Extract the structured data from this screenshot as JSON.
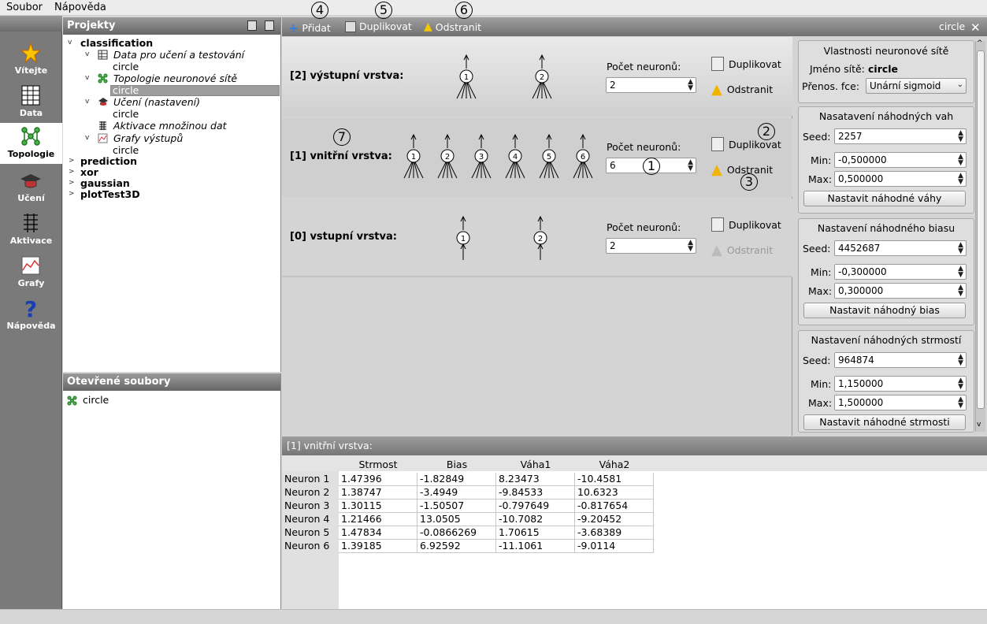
{
  "menu": {
    "file": "Soubor",
    "help": "Nápověda"
  },
  "nav": [
    {
      "label": "Vítejte",
      "icon": "star-icon"
    },
    {
      "label": "Data",
      "icon": "table-icon"
    },
    {
      "label": "Topologie",
      "icon": "network-icon"
    },
    {
      "label": "Učení",
      "icon": "graduation-cap-icon"
    },
    {
      "label": "Aktivace",
      "icon": "layers-icon"
    },
    {
      "label": "Grafy",
      "icon": "chart-icon"
    },
    {
      "label": "Nápověda",
      "icon": "question-icon"
    }
  ],
  "projects": {
    "title": "Projekty",
    "items": [
      "classification",
      "Data pro učení a testování",
      "circle",
      "Topologie neuronové sítě",
      "circle",
      "Učení (nastavení)",
      "circle",
      "Aktivace množinou dat",
      "Grafy výstupů",
      "circle",
      "prediction",
      "xor",
      "gaussian",
      "plotTest3D"
    ]
  },
  "open_files": {
    "title": "Otevřené soubory",
    "items": [
      "circle"
    ]
  },
  "toolbar": {
    "add": "Přidat",
    "duplicate": "Duplikovat",
    "remove": "Odstranit",
    "file_name": "circle"
  },
  "layers": [
    {
      "title": "[2] výstupní vrstva:",
      "count_label": "Počet neuronů:",
      "count": "2",
      "duplicate": "Duplikovat",
      "remove": "Odstranit",
      "neurons": [
        "1",
        "2"
      ]
    },
    {
      "title": "[1] vnitřní vrstva:",
      "count_label": "Počet neuronů:",
      "count": "6",
      "duplicate": "Duplikovat",
      "remove": "Odstranit",
      "neurons": [
        "1",
        "2",
        "3",
        "4",
        "5",
        "6"
      ]
    },
    {
      "title": "[0] vstupní vrstva:",
      "count_label": "Počet neuronů:",
      "count": "2",
      "duplicate": "Duplikovat",
      "remove": "Odstranit",
      "neurons": [
        "1",
        "2"
      ]
    }
  ],
  "callouts": [
    "1",
    "2",
    "3",
    "4",
    "5",
    "6",
    "7"
  ],
  "props": {
    "network_title": "Vlastnosti neuronové sítě",
    "name_label": "Jméno sítě:",
    "name_value": "circle",
    "transfer_label": "Přenos. fce:",
    "transfer_value": "Unární sigmoid",
    "weights": {
      "title": "Nasatavení náhodných vah",
      "seed_label": "Seed:",
      "seed": "2257",
      "min_label": "Min:",
      "min": "-0,500000",
      "max_label": "Max:",
      "max": "0,500000",
      "button": "Nastavit náhodné váhy"
    },
    "bias": {
      "title": "Nastavení náhodného biasu",
      "seed_label": "Seed:",
      "seed": "4452687",
      "min_label": "Min:",
      "min": "-0,300000",
      "max_label": "Max:",
      "max": "0,300000",
      "button": "Nastavit náhodný bias"
    },
    "slope": {
      "title": "Nastavení náhodných strmostí",
      "seed_label": "Seed:",
      "seed": "964874",
      "min_label": "Min:",
      "min": "1,150000",
      "max_label": "Max:",
      "max": "1,500000",
      "button": "Nastavit náhodné strmosti"
    }
  },
  "table": {
    "title": "[1] vnitřní vrstva:",
    "columns": [
      "Strmost",
      "Bias",
      "Váha1",
      "Váha2"
    ],
    "rows": [
      {
        "label": "Neuron 1",
        "cells": [
          "1.47396",
          "-1.82849",
          "8.23473",
          "-10.4581"
        ]
      },
      {
        "label": "Neuron 2",
        "cells": [
          "1.38747",
          "-3.4949",
          "-9.84533",
          "10.6323"
        ]
      },
      {
        "label": "Neuron 3",
        "cells": [
          "1.30115",
          "-1.50507",
          "-0.797649",
          "-0.817654"
        ]
      },
      {
        "label": "Neuron 4",
        "cells": [
          "1.21466",
          "13.0505",
          "-10.7082",
          "-9.20452"
        ]
      },
      {
        "label": "Neuron 5",
        "cells": [
          "1.47834",
          "-0.0866269",
          "1.70615",
          "-3.68389"
        ]
      },
      {
        "label": "Neuron 6",
        "cells": [
          "1.39185",
          "6.92592",
          "-11.1061",
          "-9.0114"
        ]
      }
    ]
  }
}
